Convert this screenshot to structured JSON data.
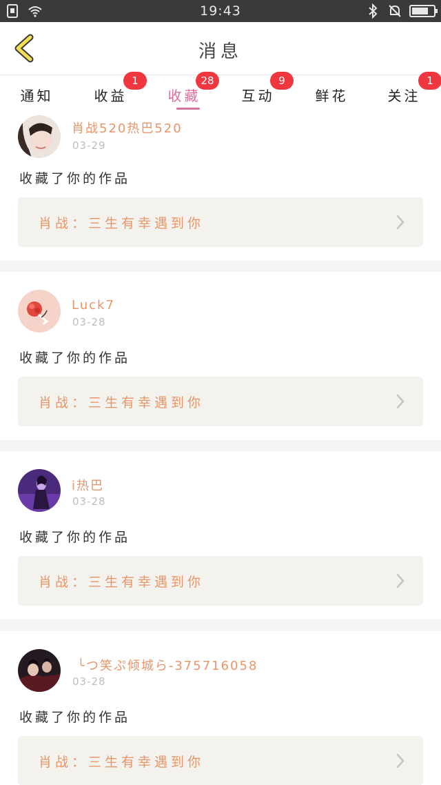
{
  "status_bar": {
    "time": "19:43",
    "battery_level": 0.75,
    "icons": [
      "sim-icon",
      "wifi-icon",
      "bluetooth-icon",
      "bell-muted-icon",
      "battery-icon"
    ]
  },
  "header": {
    "title": "消息",
    "back_icon": "chevron-left-icon"
  },
  "colors": {
    "accent": "#d86fa0",
    "badge": "#f0373f",
    "username": "#e8956a",
    "work_box": "#f3f2ec"
  },
  "tabs": [
    {
      "label": "通知",
      "badge": "",
      "active": false
    },
    {
      "label": "收益",
      "badge": "1",
      "active": false
    },
    {
      "label": "收藏",
      "badge": "28",
      "active": true
    },
    {
      "label": "互动",
      "badge": "9",
      "active": false
    },
    {
      "label": "鲜花",
      "badge": "",
      "active": false
    },
    {
      "label": "关注",
      "badge": "1",
      "active": false
    }
  ],
  "feed": [
    {
      "username": "肖战520热巴520",
      "date": "03-29",
      "action": "收藏了你的作品",
      "work_title": "肖战：三生有幸遇到你"
    },
    {
      "username": "Luck7",
      "date": "03-28",
      "action": "收藏了你的作品",
      "work_title": "肖战：三生有幸遇到你"
    },
    {
      "username": "i热巴",
      "date": "03-28",
      "action": "收藏了你的作品",
      "work_title": "肖战：三生有幸遇到你"
    },
    {
      "username": "╰つ笑ぷ倾城ら-375716058",
      "date": "03-28",
      "action": "收藏了你的作品",
      "work_title": "肖战：三生有幸遇到你"
    }
  ]
}
